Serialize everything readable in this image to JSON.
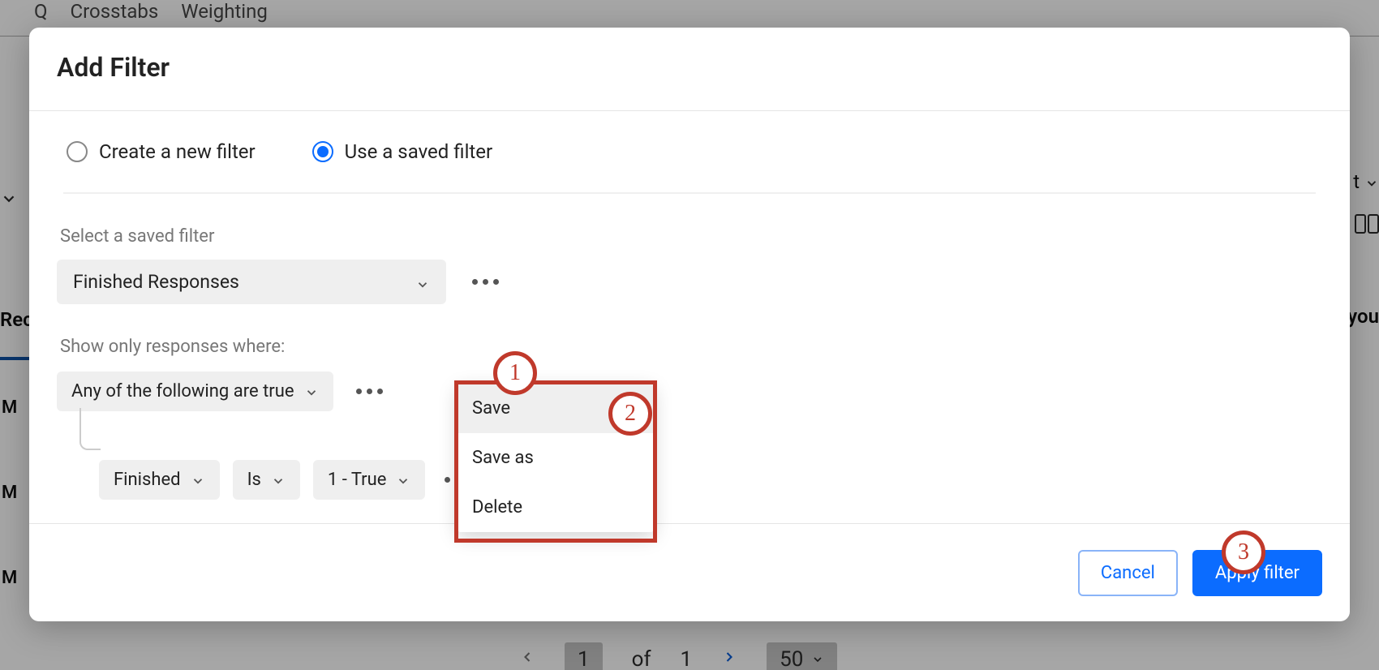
{
  "background": {
    "nav": {
      "q": "Q",
      "crosstabs": "Crosstabs",
      "weighting": "Weighting"
    },
    "leftLabels": {
      "rec": "Rec",
      "m1": "M",
      "m2": "M",
      "m3": "M"
    },
    "rightLabels": {
      "t": "t",
      "you": "you"
    },
    "pagination": {
      "page": "1",
      "of_label": "of",
      "total": "1",
      "pageSize": "50"
    }
  },
  "modal": {
    "title": "Add Filter",
    "radios": {
      "create": {
        "label": "Create a new filter",
        "selected": false
      },
      "saved": {
        "label": "Use a saved filter",
        "selected": true
      }
    },
    "savedFilter": {
      "label": "Select a saved filter",
      "value": "Finished Responses"
    },
    "showLabel": "Show only responses where:",
    "condition": {
      "group": "Any of the following are true",
      "field": "Finished",
      "operator": "Is",
      "value": "1 - True"
    },
    "menu": {
      "save": "Save",
      "saveAs": "Save as",
      "delete": "Delete"
    },
    "footer": {
      "cancel": "Cancel",
      "apply": "Apply filter"
    },
    "callouts": {
      "c1": "1",
      "c2": "2",
      "c3": "3"
    }
  }
}
